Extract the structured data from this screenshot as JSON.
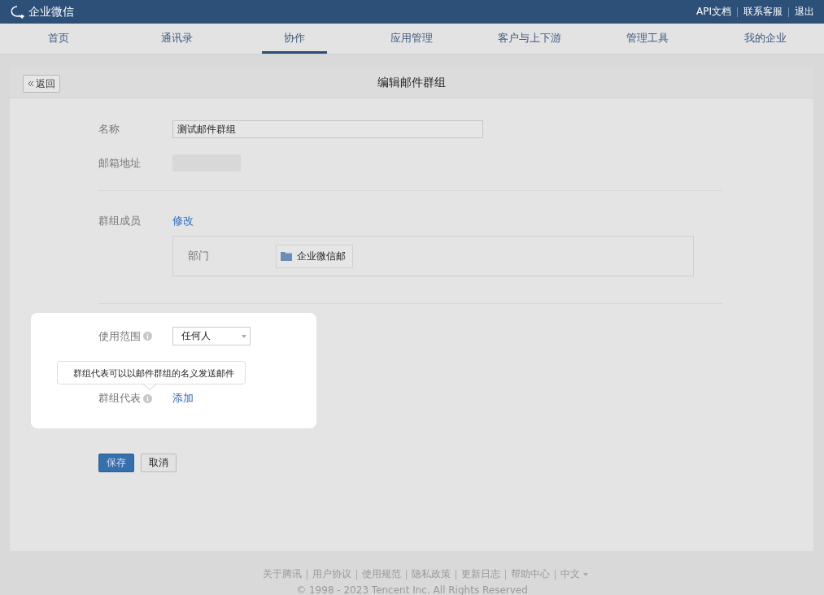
{
  "topbar": {
    "logo": "企业微信",
    "links": [
      "API文档",
      "联系客服",
      "退出"
    ]
  },
  "nav": [
    {
      "label": "首页",
      "selected": false
    },
    {
      "label": "通讯录",
      "selected": false
    },
    {
      "label": "协作",
      "selected": true
    },
    {
      "label": "应用管理",
      "selected": false
    },
    {
      "label": "客户与上下游",
      "selected": false
    },
    {
      "label": "管理工具",
      "selected": false
    },
    {
      "label": "我的企业",
      "selected": false
    }
  ],
  "card": {
    "back": "返回",
    "title": "编辑邮件群组"
  },
  "form": {
    "name_label": "名称",
    "name_value": "测试邮件群组",
    "address_label": "邮箱地址",
    "members_label": "群组成员",
    "members_edit": "修改",
    "dept_label": "部门",
    "dept_chip": "企业微信邮",
    "scope_label": "使用范围",
    "scope_value": "任何人",
    "rep_label": "群组代表",
    "rep_add": "添加",
    "tooltip": "群组代表可以以邮件群组的名义发送邮件"
  },
  "buttons": {
    "save": "保存",
    "cancel": "取消"
  },
  "footer": {
    "links": [
      "关于腾讯",
      "用户协议",
      "使用规范",
      "隐私政策",
      "更新日志",
      "帮助中心"
    ],
    "language": "中文",
    "copyright": "© 1998 - 2023 Tencent Inc. All Rights Reserved"
  }
}
